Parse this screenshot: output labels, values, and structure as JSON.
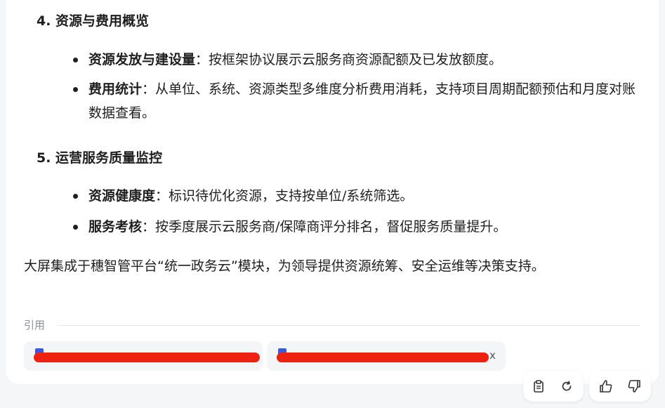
{
  "sections": [
    {
      "title": "4. 资源与费用概览",
      "bullets": [
        {
          "label": "资源发放与建设量",
          "sep": "：",
          "text": "按框架协议展示云服务商资源配额及已发放额度。"
        },
        {
          "label": "费用统计",
          "sep": "：",
          "text": "从单位、系统、资源类型多维度分析费用消耗，支持项目周期配额预估和月度对账数据查看。"
        }
      ]
    },
    {
      "title": "5. 运营服务质量监控",
      "bullets": [
        {
          "label": "资源健康度",
          "sep": "：",
          "text": "标识待优化资源，支持按单位/系统筛选。"
        },
        {
          "label": "服务考核",
          "sep": "：",
          "text": "按季度展示云服务商/保障商评分排名，督促服务质量提升。"
        }
      ]
    }
  ],
  "summary": "大屏集成于穗智管平台“统一政务云”模块，为领导提供资源统筹、安全运维等决策支持。",
  "citations": {
    "label": "引用",
    "items": [
      {
        "visible_text": ""
      },
      {
        "visible_text": "x"
      }
    ]
  },
  "actions": {
    "copy_icon": "clipboard-icon",
    "regenerate_icon": "refresh-icon",
    "like_icon": "thumbs-up-icon",
    "dislike_icon": "thumbs-down-icon"
  },
  "colors": {
    "redaction": "#ee2211",
    "doc_icon": "#3a5bd9"
  }
}
